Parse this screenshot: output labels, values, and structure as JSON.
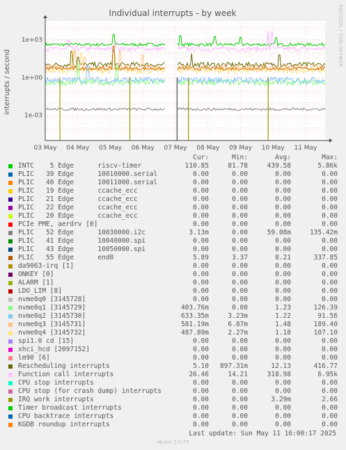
{
  "chart_data": {
    "type": "line",
    "title": "Individual interrupts - by week",
    "ylabel": "interrupts / second",
    "yscale": "log",
    "ylim": [
      1e-05,
      30000
    ],
    "yticks": [
      {
        "v": 1000,
        "label": "1e+03"
      },
      {
        "v": 1,
        "label": "1e+00"
      },
      {
        "v": 0.001,
        "label": "1e-03"
      }
    ],
    "x_tick_labels": [
      "03 May",
      "04 May",
      "05 May",
      "06 May",
      "07 May",
      "08 May",
      "09 May",
      "10 May",
      "11 May"
    ],
    "gap": [
      3.7,
      4.05
    ],
    "series": [
      {
        "name": "INTC    5 Edge      riscv-timer",
        "color": "#00cc00",
        "base": 400,
        "jitter": 0.25,
        "spikes": [
          [
            2.1,
            2500
          ],
          [
            4.15,
            2000
          ],
          [
            5.2,
            1800
          ],
          [
            6.0,
            1500
          ],
          [
            7.1,
            1400
          ]
        ]
      },
      {
        "name": "Function call interrupts",
        "color": "#ffb0ff",
        "base": 180,
        "jitter": 0.35,
        "spikes": [
          [
            0.7,
            900
          ],
          [
            6.85,
            5000
          ],
          [
            6.95,
            4000
          ],
          [
            2.2,
            600
          ]
        ]
      },
      {
        "name": "Rescheduling interrupts",
        "color": "#666600",
        "base": 10,
        "jitter": 0.4,
        "spikes": [
          [
            0.8,
            120
          ],
          [
            2.1,
            150
          ],
          [
            4.5,
            80
          ],
          [
            7.2,
            60
          ],
          [
            1.0,
            40
          ]
        ]
      },
      {
        "name": "nvme0q3 [3145731]",
        "color": "#ffc080",
        "base": 6,
        "jitter": 0.45,
        "spikes": [
          [
            0.9,
            150
          ],
          [
            2.3,
            120
          ],
          [
            3.0,
            60
          ],
          [
            1.2,
            40
          ]
        ]
      },
      {
        "name": "nvme0q4 [3145732]",
        "color": "#ffe080",
        "base": 3.5,
        "jitter": 0.45,
        "spikes": [
          [
            0.85,
            107
          ],
          [
            1.1,
            80
          ],
          [
            2.1,
            60
          ]
        ]
      },
      {
        "name": "PLIC   55 Edge      end0",
        "color": "#cc7000",
        "base": 5,
        "jitter": 0.25,
        "spikes": [
          [
            2.1,
            300
          ]
        ]
      },
      {
        "name": "nvme0q1 [3145729]",
        "color": "#80ff80",
        "base": 0.4,
        "jitter": 0.5,
        "spikes": [
          [
            1.0,
            12
          ],
          [
            2.2,
            8
          ]
        ]
      },
      {
        "name": "nvme0q2 [3145730]",
        "color": "#80c0ff",
        "base": 0.6,
        "jitter": 0.5,
        "spikes": [
          [
            1.3,
            9
          ]
        ]
      },
      {
        "name": "PLIC   52 Edge      10030000.i2c",
        "color": "#808080",
        "base": 0.003,
        "jitter": 0.2,
        "spikes": []
      }
    ],
    "drops": [
      {
        "x": 0.45,
        "color": "#999900"
      },
      {
        "x": 2.6,
        "color": "#999900"
      },
      {
        "x": 4.05,
        "color": "#444"
      },
      {
        "x": 4.4,
        "color": "#999900"
      },
      {
        "x": 6.85,
        "color": "#999900"
      }
    ],
    "legend_header": [
      "Cur:",
      "Min:",
      "Avg:",
      "Max:"
    ],
    "legend": [
      {
        "name": "INTC    5 Edge      riscv-timer",
        "color": "#00cc00",
        "cur": "110.85",
        "min": "81.78",
        "avg": "439.58",
        "max": "5.86k"
      },
      {
        "name": "PLIC   39 Edge      10010000.serial",
        "color": "#0066b3",
        "cur": "0.00",
        "min": "0.00",
        "avg": "0.00",
        "max": "0.00"
      },
      {
        "name": "PLIC   40 Edge      10011000.serial",
        "color": "#ff8000",
        "cur": "0.00",
        "min": "0.00",
        "avg": "0.00",
        "max": "0.00"
      },
      {
        "name": "PLIC   19 Edge      ccache_ecc",
        "color": "#ffcc00",
        "cur": "0.00",
        "min": "0.00",
        "avg": "0.00",
        "max": "0.00"
      },
      {
        "name": "PLIC   21 Edge      ccache_ecc",
        "color": "#330099",
        "cur": "0.00",
        "min": "0.00",
        "avg": "0.00",
        "max": "0.00"
      },
      {
        "name": "PLIC   22 Edge      ccache_ecc",
        "color": "#990099",
        "cur": "0.00",
        "min": "0.00",
        "avg": "0.00",
        "max": "0.00"
      },
      {
        "name": "PLIC   20 Edge      ccache_ecc",
        "color": "#ccff00",
        "cur": "0.00",
        "min": "0.00",
        "avg": "0.00",
        "max": "0.00"
      },
      {
        "name": "PCIe PME, aerdrv [0]",
        "color": "#ff0000",
        "cur": "0.00",
        "min": "0.00",
        "avg": "0.00",
        "max": "0.00"
      },
      {
        "name": "PLIC   52 Edge      10030000.i2c",
        "color": "#808080",
        "cur": "3.13m",
        "min": "0.00",
        "avg": "59.08m",
        "max": "135.42m"
      },
      {
        "name": "PLIC   41 Edge      10040000.spi",
        "color": "#008f00",
        "cur": "0.00",
        "min": "0.00",
        "avg": "0.00",
        "max": "0.00"
      },
      {
        "name": "PLIC   43 Edge      10050000.spi",
        "color": "#00487d",
        "cur": "0.00",
        "min": "0.00",
        "avg": "0.00",
        "max": "0.00"
      },
      {
        "name": "PLIC   55 Edge      end0",
        "color": "#b35a00",
        "cur": "5.89",
        "min": "3.37",
        "avg": "8.21",
        "max": "337.85"
      },
      {
        "name": "da9063-irq [1]",
        "color": "#b38f00",
        "cur": "0.00",
        "min": "0.00",
        "avg": "0.00",
        "max": "0.00"
      },
      {
        "name": "ONKEY [0]",
        "color": "#6b006b",
        "cur": "0.00",
        "min": "0.00",
        "avg": "0.00",
        "max": "0.00"
      },
      {
        "name": "ALARM [1]",
        "color": "#8fb300",
        "cur": "0.00",
        "min": "0.00",
        "avg": "0.00",
        "max": "0.00"
      },
      {
        "name": "LDO_LIM [8]",
        "color": "#b30000",
        "cur": "0.00",
        "min": "0.00",
        "avg": "0.00",
        "max": "0.00"
      },
      {
        "name": "nvme0q0 [3145728]",
        "color": "#bebebe",
        "cur": "0.00",
        "min": "0.00",
        "avg": "0.00",
        "max": "0.00"
      },
      {
        "name": "nvme0q1 [3145729]",
        "color": "#80ff80",
        "cur": "403.76m",
        "min": "0.00",
        "avg": "1.23",
        "max": "126.39"
      },
      {
        "name": "nvme0q2 [3145730]",
        "color": "#80c9ff",
        "cur": "633.35m",
        "min": "3.23m",
        "avg": "1.22",
        "max": "91.56"
      },
      {
        "name": "nvme0q3 [3145731]",
        "color": "#ffc080",
        "cur": "581.19m",
        "min": "6.87m",
        "avg": "1.48",
        "max": "189.40"
      },
      {
        "name": "nvme0q4 [3145732]",
        "color": "#ffe680",
        "cur": "487.89m",
        "min": "2.27m",
        "avg": "1.18",
        "max": "107.10"
      },
      {
        "name": "spi1.0 cd [15]",
        "color": "#aa80ff",
        "cur": "0.00",
        "min": "0.00",
        "avg": "0.00",
        "max": "0.00"
      },
      {
        "name": "xhci_hcd [2097152]",
        "color": "#ee00cc",
        "cur": "0.00",
        "min": "0.00",
        "avg": "0.00",
        "max": "0.00"
      },
      {
        "name": "lm90 [6]",
        "color": "#ff8080",
        "cur": "0.00",
        "min": "0.00",
        "avg": "0.00",
        "max": "0.00"
      },
      {
        "name": "Rescheduling interrupts",
        "color": "#666600",
        "cur": "5.10",
        "min": "897.31m",
        "avg": "12.13",
        "max": "416.77"
      },
      {
        "name": "Function call interrupts",
        "color": "#ffbfff",
        "cur": "26.46",
        "min": "14.21",
        "avg": "318.98",
        "max": "6.95k"
      },
      {
        "name": "CPU stop interrupts",
        "color": "#00ffcc",
        "cur": "0.00",
        "min": "0.00",
        "avg": "0.00",
        "max": "0.00"
      },
      {
        "name": "CPU stop (for crash dump) interrupts",
        "color": "#cc6699",
        "cur": "0.00",
        "min": "0.00",
        "avg": "0.00",
        "max": "0.00"
      },
      {
        "name": "IRQ work interrupts",
        "color": "#999900",
        "cur": "0.00",
        "min": "0.00",
        "avg": "3.29m",
        "max": "2.66"
      },
      {
        "name": "Timer broadcast interrupts",
        "color": "#00cc00",
        "cur": "0.00",
        "min": "0.00",
        "avg": "0.00",
        "max": "0.00"
      },
      {
        "name": "CPU backtrace interrupts",
        "color": "#0066b3",
        "cur": "0.00",
        "min": "0.00",
        "avg": "0.00",
        "max": "0.00"
      },
      {
        "name": "KGDB roundup interrupts",
        "color": "#ff8000",
        "cur": "0.00",
        "min": "0.00",
        "avg": "0.00",
        "max": "0.00"
      }
    ]
  },
  "footer": {
    "last_update": "Last update: Sun May 11 16:00:17 2025",
    "munin": "Munin 2.0.75",
    "side_label": "RRDTOOL / TOBI OETIKER"
  }
}
